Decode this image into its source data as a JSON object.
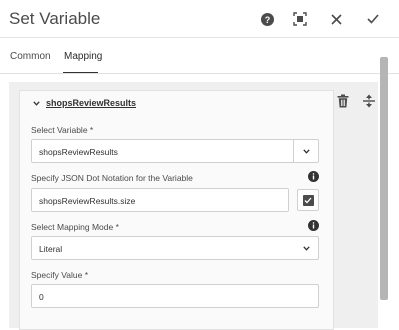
{
  "dialog": {
    "title": "Set Variable"
  },
  "header_actions": {
    "help_icon": "help-icon",
    "fullscreen_icon": "fullscreen-icon",
    "close_icon": "close-icon",
    "done_icon": "checkmark-icon"
  },
  "tabs": [
    {
      "label": "Common",
      "active": false
    },
    {
      "label": "Mapping",
      "active": true
    }
  ],
  "mapping_item": {
    "title": "shopsReviewResults",
    "delete_icon": "trash-icon",
    "reorder_icon": "move-vertical-icon",
    "select_variable": {
      "label": "Select Variable *",
      "value": "shopsReviewResults"
    },
    "json_dot_notation": {
      "label": "Specify JSON Dot Notation for the Variable",
      "value": "shopsReviewResults.size",
      "checked": true
    },
    "mapping_mode": {
      "label": "Select Mapping Mode *",
      "value": "Literal"
    },
    "specify_value": {
      "label": "Specify Value *",
      "value": "0"
    }
  },
  "colors": {
    "accent": "#323232",
    "panel_bg": "#efefef",
    "card_bg": "#fafafa"
  }
}
